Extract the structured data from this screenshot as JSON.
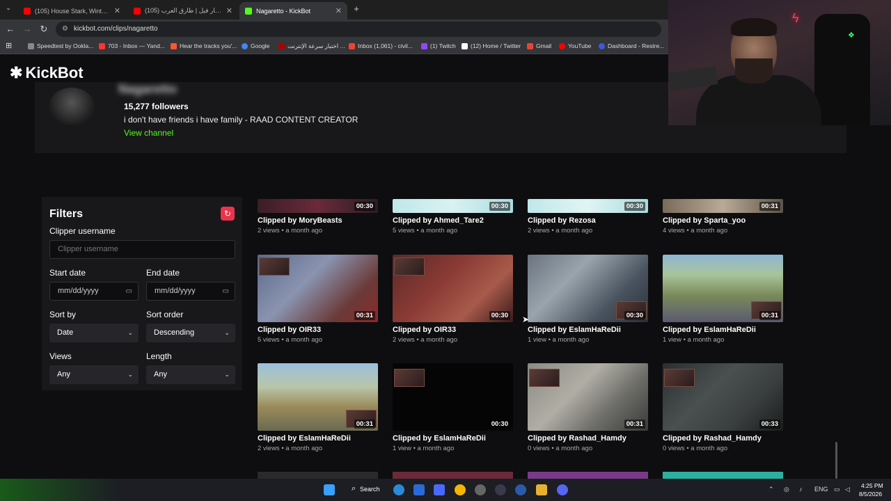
{
  "browser": {
    "tabs": [
      {
        "label": "(105) House Stark, Winterfell Th",
        "active": false,
        "favicon_color": "#ff0000"
      },
      {
        "label": "(105) شارة بابار فيل | طارق العرب",
        "active": false,
        "favicon_color": "#ff0000"
      },
      {
        "label": "Nagaretto - KickBot",
        "active": true,
        "favicon_color": "#53fc18"
      }
    ],
    "new_tab_icon": "+",
    "url": "kickbot.com/clips/nagaretto",
    "bookmarks": [
      {
        "label": "Speedtest by Ookla...",
        "color": "#888"
      },
      {
        "label": "703 - Inbox — Yand...",
        "color": "#f33"
      },
      {
        "label": "Hear the tracks you'...",
        "color": "#f53"
      },
      {
        "label": "Google",
        "color": "#4285f4"
      },
      {
        "label": "اختبار سرعة الإنترنت ...",
        "color": "#a00"
      },
      {
        "label": "Inbox (1,061) - civil...",
        "color": "#ea4335"
      },
      {
        "label": "(1) Twitch",
        "color": "#9146ff"
      },
      {
        "label": "(12) Home / Twitter",
        "color": "#fff"
      },
      {
        "label": "Gmail",
        "color": "#ea4335"
      },
      {
        "label": "YouTube",
        "color": "#f00"
      },
      {
        "label": "Dashboard - Restre...",
        "color": "#3b5bdb"
      }
    ]
  },
  "site": {
    "logo": "KickBot",
    "accent": "#53fc18"
  },
  "channel": {
    "name": "Nagaretto",
    "followers": "15,277 followers",
    "bio": "i don't have friends i have family - RAAD CONTENT CREATOR",
    "view_channel": "View channel"
  },
  "filters": {
    "title": "Filters",
    "reset_icon": "refresh-icon",
    "clipper_label": "Clipper username",
    "clipper_placeholder": "Clipper username",
    "start_label": "Start date",
    "start_value": "mm/dd/yyyy",
    "end_label": "End date",
    "end_value": "mm/dd/yyyy",
    "sort_by_label": "Sort by",
    "sort_by_value": "Date",
    "sort_order_label": "Sort order",
    "sort_order_value": "Descending",
    "views_label": "Views",
    "views_value": "Any",
    "length_label": "Length",
    "length_value": "Any"
  },
  "clips": [
    {
      "title": "Clipped by MoryBeasts",
      "meta": "2 views • a month ago",
      "duration": "00:30"
    },
    {
      "title": "Clipped by Ahmed_Tare2",
      "meta": "5 views • a month ago",
      "duration": "00:30"
    },
    {
      "title": "Clipped by Rezosa",
      "meta": "2 views • a month ago",
      "duration": "00:30"
    },
    {
      "title": "Clipped by Sparta_yoo",
      "meta": "4 views • a month ago",
      "duration": "00:31"
    },
    {
      "title": "Clipped by OIR33",
      "meta": "5 views • a month ago",
      "duration": "00:31"
    },
    {
      "title": "Clipped by OIR33",
      "meta": "2 views • a month ago",
      "duration": "00:30"
    },
    {
      "title": "Clipped by EslamHaReDii",
      "meta": "1 view • a month ago",
      "duration": "00:30"
    },
    {
      "title": "Clipped by EslamHaReDii",
      "meta": "1 view • a month ago",
      "duration": "00:31"
    },
    {
      "title": "Clipped by EslamHaReDii",
      "meta": "2 views • a month ago",
      "duration": "00:31"
    },
    {
      "title": "Clipped by EslamHaReDii",
      "meta": "1 view • a month ago",
      "duration": "00:30"
    },
    {
      "title": "Clipped by Rashad_Hamdy",
      "meta": "0 views • a month ago",
      "duration": "00:31"
    },
    {
      "title": "Clipped by Rashad_Hamdy",
      "meta": "0 views • a month ago",
      "duration": "00:33"
    }
  ],
  "taskbar": {
    "search_label": "Search",
    "language": "ENG",
    "time": "4:25 PM",
    "date": "8/5/2026"
  }
}
